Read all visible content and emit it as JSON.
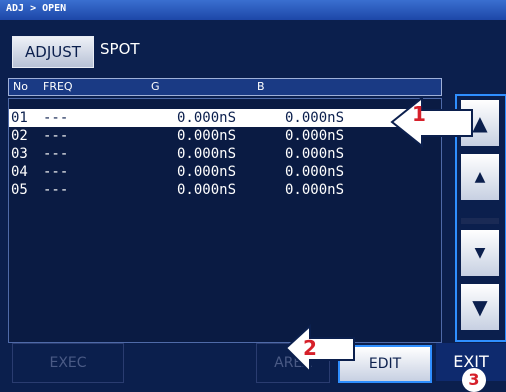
{
  "topbar": {
    "title": "ADJ > OPEN"
  },
  "mode": {
    "adjust": "ADJUST",
    "spot": "SPOT"
  },
  "table": {
    "headers": {
      "no": "No",
      "freq": "FREQ",
      "g": "G",
      "b": "B"
    },
    "rows": [
      {
        "no": "01",
        "freq": "---",
        "g": "0.000nS",
        "b": "0.000nS"
      },
      {
        "no": "02",
        "freq": "---",
        "g": "0.000nS",
        "b": "0.000nS"
      },
      {
        "no": "03",
        "freq": "---",
        "g": "0.000nS",
        "b": "0.000nS"
      },
      {
        "no": "04",
        "freq": "---",
        "g": "0.000nS",
        "b": "0.000nS"
      },
      {
        "no": "05",
        "freq": "---",
        "g": "0.000nS",
        "b": "0.000nS"
      }
    ]
  },
  "scroll": {
    "top": "▲",
    "up": "▲",
    "down": "▼",
    "bottom": "▼"
  },
  "buttons": {
    "exec": "EXEC",
    "area": "AREA",
    "edit": "EDIT",
    "exit": "EXIT"
  },
  "callouts": {
    "one": "1",
    "two": "2",
    "three": "3"
  },
  "colors": {
    "background": "#0b1f4d",
    "highlight": "#2f8fff",
    "callout": "#d6202a"
  }
}
